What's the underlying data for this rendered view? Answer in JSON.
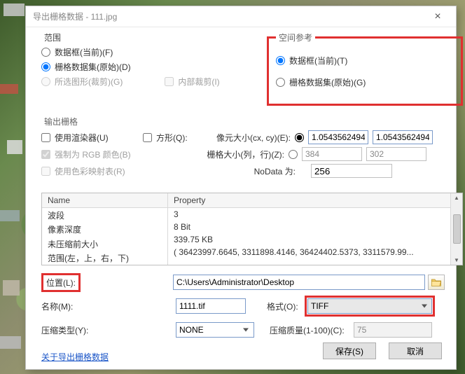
{
  "window": {
    "title": "导出栅格数据 - 111.jpg"
  },
  "extent": {
    "legend": "范围",
    "opt_dataframe_current": "数据框(当前)(F)",
    "opt_rasterdataset_orig": "栅格数据集(原始)(D)",
    "opt_selected_graphics": "所选图形(裁剪)(G)",
    "chk_internal_clip": "内部裁剪(I)"
  },
  "spatial_ref": {
    "legend": "空间参考",
    "opt_dataframe_current": "数据框(当前)(T)",
    "opt_rasterdataset_orig": "栅格数据集(原始)(G)"
  },
  "output_raster": {
    "legend": "输出栅格",
    "chk_use_renderer": "使用渲染器(U)",
    "chk_square": "方形(Q):",
    "pixel_size_label": "像元大小(cx, cy)(E):",
    "pixel_size_cx": "1.0543562494",
    "pixel_size_cy": "1.0543562494",
    "chk_force_rgb": "强制为 RGB 颜色(B)",
    "raster_size_label": "栅格大小(列，行)(Z):",
    "raster_size_cols": "384",
    "raster_size_rows": "302",
    "chk_use_colormap": "使用色彩映射表(R)",
    "nodata_label": "NoData 为:",
    "nodata_value": "256"
  },
  "props": {
    "header_name": "Name",
    "header_property": "Property",
    "rows": [
      {
        "name": "波段",
        "property": "3"
      },
      {
        "name": "像素深度",
        "property": "8 Bit"
      },
      {
        "name": "未压缩前大小",
        "property": "339.75 KB"
      },
      {
        "name": "范围(左，上，右，下)",
        "property": "( 36423997.6645, 3311898.4146, 36424402.5373, 3311579.99..."
      }
    ]
  },
  "form": {
    "location_label": "位置(L):",
    "location_value": "C:\\Users\\Administrator\\Desktop",
    "name_label": "名称(M):",
    "name_value": "1111.tif",
    "format_label": "格式(O):",
    "format_value": "TIFF",
    "compression_type_label": "压缩类型(Y):",
    "compression_type_value": "NONE",
    "compression_quality_label": "压缩质量(1-100)(C):",
    "compression_quality_value": "75"
  },
  "link": "关于导出栅格数据",
  "buttons": {
    "save": "保存(S)",
    "cancel": "取消"
  }
}
